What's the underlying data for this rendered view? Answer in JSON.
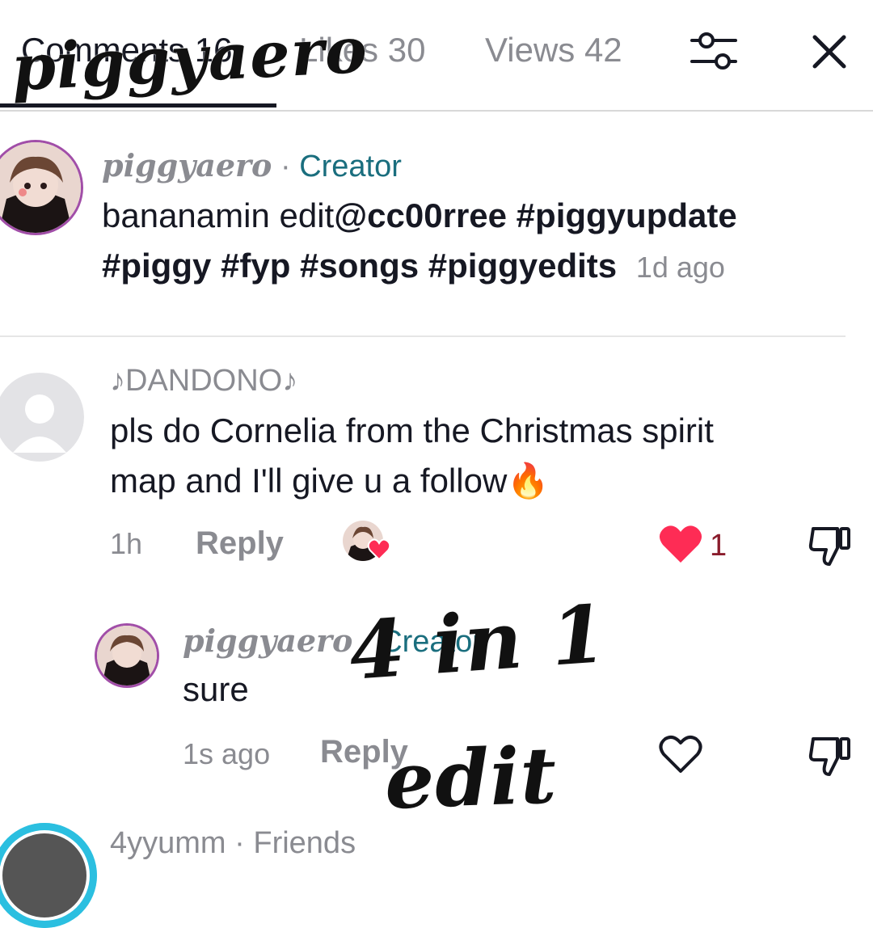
{
  "header": {
    "tabs": [
      {
        "label": "Comments 16",
        "active": true
      },
      {
        "label": "Likes 30",
        "active": false
      },
      {
        "label": "Views 42",
        "active": false
      }
    ],
    "filter_icon": "sliders-icon",
    "close_icon": "close-icon"
  },
  "overlay": {
    "name": "piggyaero",
    "line1": "4 in 1",
    "line2": "edit"
  },
  "creator_post": {
    "username": "piggyaero",
    "separator": " · ",
    "tag": "Creator",
    "text_plain": "bananamin edit",
    "text_bold_1": "@cc00rree #piggyupdate",
    "text_bold_2": "#piggy #fyp #songs #piggyedits",
    "time": "1d ago"
  },
  "comment": {
    "username": "♪DANDONO♪",
    "text_line1": "pls do Cornelia from the Christmas spirit",
    "text_line2": "map and I'll give u a follow",
    "emoji": "🔥",
    "time": "1h",
    "reply_label": "Reply",
    "like_count": "1",
    "liked": true
  },
  "reply": {
    "username": "piggyaero",
    "separator": " · ",
    "tag": "Creator",
    "text": "sure",
    "time": "1s ago",
    "reply_label": "Reply"
  },
  "next_comment": {
    "username": "4yyumm",
    "separator": " · ",
    "tag": "Friends"
  },
  "colors": {
    "accent_teal": "#1a6e7e",
    "heart_red": "#fe2c55",
    "avatar_ring": "#a14ea8"
  }
}
